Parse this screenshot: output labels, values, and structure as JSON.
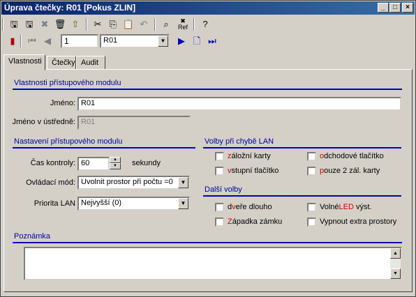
{
  "window": {
    "title": "Úprava čtečky: R01 [Pokus ZLIN]"
  },
  "toolbar2": {
    "record_number": "1",
    "record_combo": "R01"
  },
  "tabs": [
    "Vlastnosti",
    "Čtečky",
    "Audit"
  ],
  "section_module": {
    "title": "Vlastnosti přístupového modulu",
    "name_label": "Jméno:",
    "name_value": "R01",
    "central_label": "Jméno v ústředně:",
    "central_value": "R01"
  },
  "section_settings": {
    "title": "Nastavení přístupového modulu",
    "interval_label": "Čas kontroly:",
    "interval_value": "60",
    "interval_unit": "sekundy",
    "mode_label": "Ovládací mód:",
    "mode_value": "Uvolnit prostor při počtu =0",
    "priority_label": "Priorita LAN",
    "priority_value": "Nejvyšší (0)"
  },
  "section_lan": {
    "title": "Volby při chybě LAN",
    "opt1_hot": "z",
    "opt1_rest": "áložní karty",
    "opt2_hot": "o",
    "opt2_rest": "dchodové tlačítko",
    "opt3_hot": "v",
    "opt3_rest": "stupní tlačítko",
    "opt4_hot": "p",
    "opt4_rest": "ouze 2 zál. karty"
  },
  "section_other": {
    "title": "Další volby",
    "opt1_pre": "d",
    "opt1_hot": "v",
    "opt1_rest": "eře dlouho",
    "opt2_pre": "Volné",
    "opt2_hot": "LED",
    "opt2_rest": " výst.",
    "opt3_hot": "Z",
    "opt3_rest": "ápadka zámku",
    "opt4_label": "Vypnout extra prostory"
  },
  "section_note": {
    "title": "Poznámka"
  },
  "colors": {
    "title_start": "#0a246a",
    "title_end": "#3a6ea5",
    "section": "#0000a0",
    "hotkey": "#d00000"
  }
}
